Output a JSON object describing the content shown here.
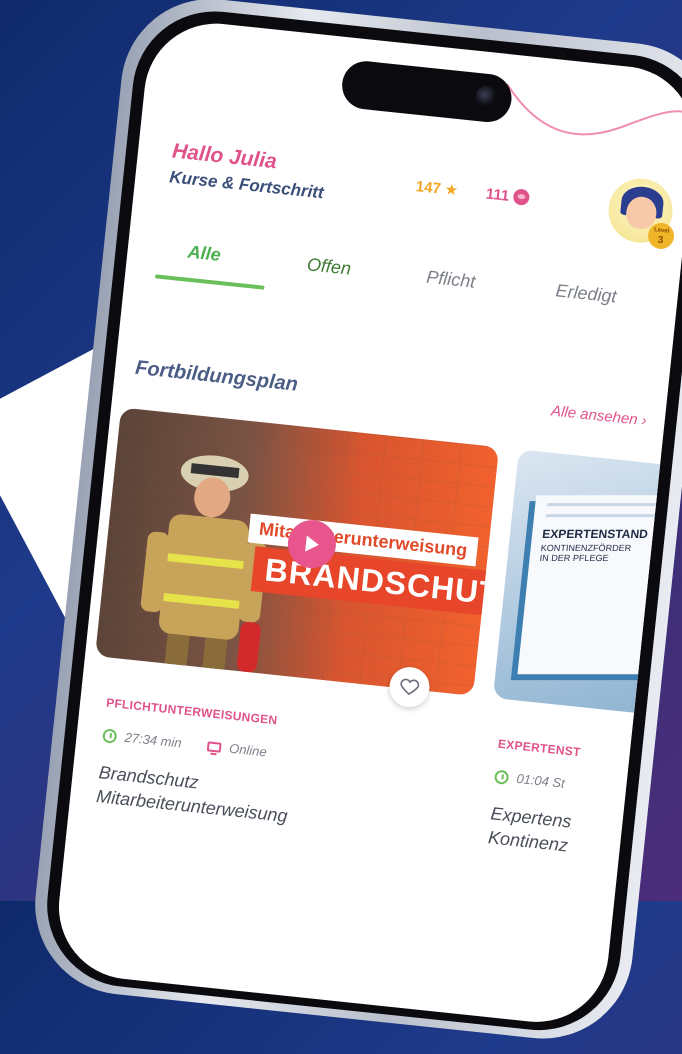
{
  "header": {
    "greeting": "Hallo Julia",
    "subtitle": "Kurse & Fortschritt"
  },
  "stats": {
    "stars": "147",
    "coins": "111"
  },
  "avatar": {
    "level_label": "Level",
    "level_value": "3"
  },
  "tabs": [
    {
      "label": "Alle",
      "active": true
    },
    {
      "label": "Offen",
      "active": false
    },
    {
      "label": "Pflicht",
      "active": false
    },
    {
      "label": "Erledigt",
      "active": false
    }
  ],
  "section": {
    "title": "Fortbildungsplan",
    "see_all": "Alle ansehen"
  },
  "cards": [
    {
      "banner_top": "Mitarbeiterunterweisung",
      "banner_bottom": "BRANDSCHUTZ",
      "category": "PFLICHTUNTERWEISUNGEN",
      "duration": "27:34 min",
      "mode": "Online",
      "title_line1": "Brandschutz",
      "title_line2": "Mitarbeiterunterweisung"
    },
    {
      "book_title": "EXPERTENSTAND",
      "book_sub1": "KONTINENZFÖRDER",
      "book_sub2": "IN DER PFLEGE",
      "category": "EXPERTENST",
      "duration": "01:04 St",
      "title_line1": "Expertens",
      "title_line2": "Kontinenz"
    }
  ],
  "colors": {
    "accent_pink": "#e0528a",
    "accent_green": "#6bbf5a",
    "star": "#f5a524",
    "navy": "#3a4f7a"
  }
}
